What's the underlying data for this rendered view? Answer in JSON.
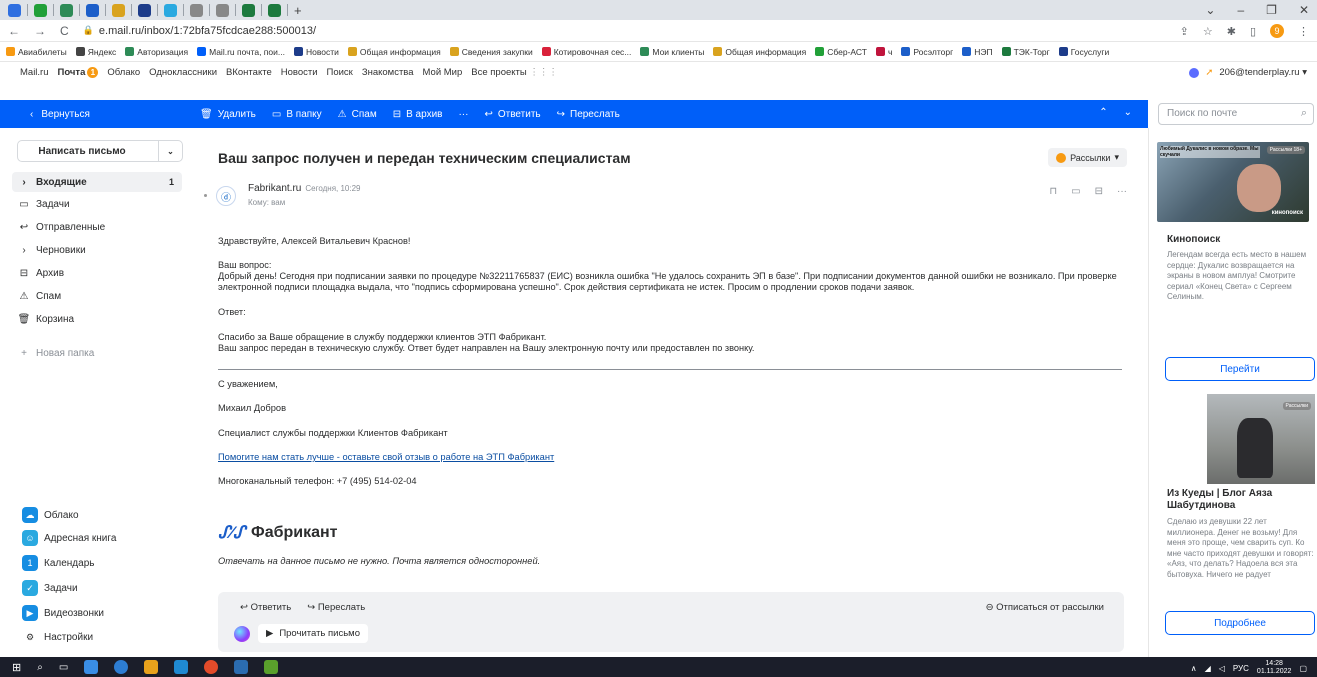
{
  "browser": {
    "url": "e.mail.ru/inbox/1:72bfa75fcdcae288:500013/",
    "new_tab": "+",
    "nav_back": "←",
    "nav_forward": "→",
    "reload": "C",
    "profile_initial": "9",
    "win_minimize": "–",
    "win_restore": "❐",
    "win_close": "✕",
    "win_chevron": "⌄"
  },
  "bookmarks": [
    {
      "label": "Авиабилеты",
      "color": "#f79a12"
    },
    {
      "label": "Яндекс",
      "color": "#444"
    },
    {
      "label": "Авторизация",
      "color": "#2e8b57"
    },
    {
      "label": "Mail.ru почта, пои...",
      "color": "#005ff9"
    },
    {
      "label": "Новости",
      "color": "#1d3c8a"
    },
    {
      "label": "Общая информация",
      "color": "#d9a31f"
    },
    {
      "label": "Сведения закупки",
      "color": "#d9a31f"
    },
    {
      "label": "Котировочная сес...",
      "color": "#d9213a"
    },
    {
      "label": "Мои клиенты",
      "color": "#2e8b57"
    },
    {
      "label": "Общая информация",
      "color": "#d9a31f"
    },
    {
      "label": "Сбер-АСТ",
      "color": "#21a038"
    },
    {
      "label": "ч",
      "color": "#c0143c"
    },
    {
      "label": "Росэлторг",
      "color": "#1c5ec9"
    },
    {
      "label": "НЭП",
      "color": "#1c5ec9"
    },
    {
      "label": "ТЭК-Торг",
      "color": "#1d7a3e"
    },
    {
      "label": "Госуслуги",
      "color": "#1d3c8a"
    }
  ],
  "portal": {
    "items": [
      "Mail.ru",
      "Почта",
      "Облако",
      "Одноклассники",
      "ВКонтакте",
      "Новости",
      "Поиск",
      "Знакомства",
      "Мой Мир",
      "Все проекты"
    ],
    "mail_badge": "1",
    "account": "206@tenderplay.ru"
  },
  "toolbar": {
    "back": "Вернуться",
    "delete": "Удалить",
    "to_folder": "В папку",
    "spam": "Спам",
    "archive": "В архив",
    "more": "···",
    "reply": "Ответить",
    "forward": "Переслать",
    "up": "⌃",
    "down": "⌄"
  },
  "search": {
    "placeholder": "Поиск по почте"
  },
  "sidebar": {
    "compose": "Написать письмо",
    "folders": [
      {
        "icon": "›",
        "label": "Входящие",
        "count": "1",
        "active": true
      },
      {
        "icon": "▭",
        "label": "Задачи",
        "count": ""
      },
      {
        "icon": "↩",
        "label": "Отправленные",
        "count": ""
      },
      {
        "icon": "›",
        "label": "Черновики",
        "count": ""
      },
      {
        "icon": "⊟",
        "label": "Архив",
        "count": ""
      },
      {
        "icon": "⚠",
        "label": "Спам",
        "count": ""
      },
      {
        "icon": "🗑",
        "label": "Корзина",
        "count": ""
      }
    ],
    "new_folder": "Новая папка",
    "apps": [
      {
        "label": "Облако",
        "color": "#168de2",
        "glyph": "☁"
      },
      {
        "label": "Адресная книга",
        "color": "#2aa9e0",
        "glyph": "☺"
      },
      {
        "label": "Календарь",
        "color": "#168de2",
        "glyph": "1"
      },
      {
        "label": "Задачи",
        "color": "#2aa9e0",
        "glyph": "✓"
      },
      {
        "label": "Видеозвонки",
        "color": "#168de2",
        "glyph": "▶"
      },
      {
        "label": "Настройки",
        "color": "#ffffff",
        "glyph": "⚙"
      }
    ]
  },
  "message": {
    "subject": "Ваш запрос получен и передан техническим специалистам",
    "category": "Рассылки",
    "sender": "Fabrikant.ru",
    "time": "Сегодня, 10:29",
    "to": "Кому: вам",
    "greeting": "Здравствуйте, Алексей Витальевич Краснов!",
    "question_label": "Ваш вопрос:",
    "question_text": "Добрый день! Сегодня при подписании заявки по процедуре №32211765837 (ЕИС) возникла ошибка \"Не удалось сохранить ЭП в базе\". При подписании документов данной ошибки не возникало. При проверке электронной подписи площадка выдала, что \"подпись сформирована успешно\". Срок действия сертификата не истек. Просим о продлении сроков подачи заявок.",
    "answer_label": "Ответ:",
    "answer_line1": "Спасибо за Ваше обращение в службу поддержки клиентов ЭТП Фабрикант.",
    "answer_line2": "Ваш запрос передан в техническую службу. Ответ будет направлен на Вашу электронную почту или предоставлен по звонку.",
    "regards": "С уважением,",
    "name": "Михаил Добров",
    "position": "Специалист службы поддержки Клиентов Фабрикант",
    "feedback_link": "Помогите нам стать лучше - оставьте свой отзыв о работе на ЭТП Фабрикант",
    "phone": "Многоканальный телефон: +7 (495) 514-02-04",
    "logo_text": "Фабрикант",
    "noreply": "Отвечать на данное письмо не нужно. Почта является односторонней."
  },
  "footer": {
    "reply": "Ответить",
    "forward": "Переслать",
    "unsubscribe": "Отписаться от рассылки",
    "read_aloud": "Прочитать письмо"
  },
  "ads": {
    "ad1_overlay_title": "Любимый Дукалис в новом образе. Мы скучали",
    "ad1_tag": "Рассылки 18+",
    "ad1_brand": "кинопоиск",
    "ad1_title": "Кинопоиск",
    "ad1_text": "Легендам всегда есть место в нашем сердце: Дукалис возвращается на экраны в новом амплуа! Смотрите сериал «Конец Света» с Сергеем Селиным.",
    "ad1_button": "Перейти",
    "ad2_tag": "Рассылки",
    "ad2_title": "Из Куеды | Блог Аяза Шабутдинова",
    "ad2_text": "Сделаю из девушки 22 лет миллионера. Денег не возьму! Для меня это проще, чем сварить суп. Ко мне часто приходят девушки и говорят: «Аяз, что делать? Надоела вся эта бытовуха. Ничего не радует",
    "ad2_button": "Подробнее"
  },
  "taskbar": {
    "lang": "РУС",
    "time": "14:28",
    "date": "01.11.2022"
  }
}
